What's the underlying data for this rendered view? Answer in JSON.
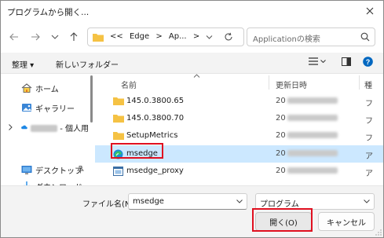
{
  "window": {
    "title": "プログラムから開く..."
  },
  "nav": {
    "back_icon": "arrow-left-icon",
    "forward_icon": "arrow-right-icon",
    "recent_icon": "chevron-down-icon",
    "up_icon": "arrow-up-icon",
    "breadcrumb": [
      "<<",
      "Edge",
      ">",
      "Ap...",
      ">"
    ],
    "search_placeholder": "Applicationの検索"
  },
  "toolbar": {
    "organize_label": "整理 ▾",
    "new_folder_label": "新しいフォルダー"
  },
  "sidebar": {
    "items": [
      {
        "label": "ホーム",
        "icon": "home-icon"
      },
      {
        "label": "ギャラリー",
        "icon": "gallery-icon"
      },
      {
        "label": " - 個人用",
        "icon": "cloud-icon"
      },
      {
        "label": "デスクトップ",
        "icon": "desktop-icon"
      },
      {
        "label": "ダウンロード",
        "icon": "download-icon"
      }
    ]
  },
  "columns": {
    "name": "名前",
    "date": "更新日時",
    "type": "種"
  },
  "files": [
    {
      "name": "145.0.3800.65",
      "date": "20",
      "type": "フ",
      "icon": "folder-icon"
    },
    {
      "name": "145.0.3800.70",
      "date": "20",
      "type": "フ",
      "icon": "folder-icon"
    },
    {
      "name": "SetupMetrics",
      "date": "20",
      "type": "フ",
      "icon": "folder-icon"
    },
    {
      "name": "msedge",
      "date": "20",
      "type": "ア",
      "icon": "edge-icon",
      "selected": true
    },
    {
      "name": "msedge_proxy",
      "date": "20",
      "type": "ア",
      "icon": "app-icon"
    }
  ],
  "bottom": {
    "filename_label": "ファイル名(N):",
    "filename_value": "msedge",
    "filetype_value": "プログラム",
    "open_label": "開く(O)",
    "cancel_label": "キャンセル"
  },
  "colors": {
    "accent": "#0067c0",
    "selection": "#cce8ff",
    "highlight_box": "#e01020",
    "folder": "#f5c244"
  }
}
